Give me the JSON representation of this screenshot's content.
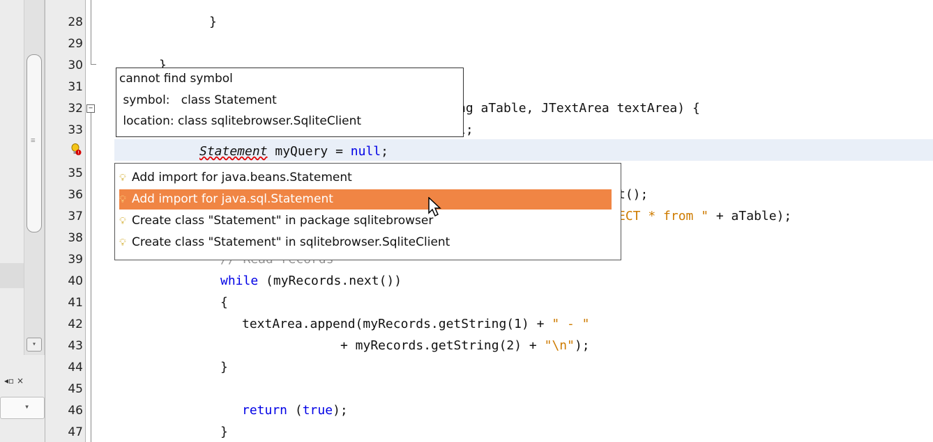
{
  "gutter": {
    "line_numbers": [
      "28",
      "29",
      "30",
      "31",
      "32",
      "33",
      "",
      "35",
      "36",
      "37",
      "38",
      "39",
      "40",
      "41",
      "42",
      "43",
      "44",
      "45",
      "46",
      "47"
    ]
  },
  "side_panel": {
    "tab_close_label": "◂▫ ×"
  },
  "code": {
    "l28": "}",
    "l30": "}",
    "l32_tail": "ng aTable, JTextArea textArea) {",
    "l33_tail": "l;",
    "l34_type": "Statement",
    "l34_rest": " myQuery = ",
    "l34_null": "null",
    "l34_end": ";",
    "l36_tail": "t();",
    "l37_str": "ECT * from \"",
    "l37_rest": " + aTable);",
    "l39_comment": "// Read records",
    "l40_kw": "while",
    "l40_rest": " (myRecords.next())",
    "l41": "{",
    "l42_a": "textArea.append(myRecords.getString(1) + ",
    "l42_str": "\" - \"",
    "l43_a": "+ myRecords.getString(2) + ",
    "l43_str": "\"\\n\"",
    "l43_end": ");",
    "l44": "}",
    "l46_kw": "return",
    "l46_rest": " (",
    "l46_true": "true",
    "l46_end": ");",
    "l47": "}"
  },
  "tooltip": {
    "title": "cannot find symbol",
    "symbol": " symbol:   class Statement",
    "location": " location: class sqlitebrowser.SqliteClient"
  },
  "suggestions": {
    "items": [
      {
        "label": "Add import for java.beans.Statement",
        "selected": false
      },
      {
        "label": "Add import for java.sql.Statement",
        "selected": true
      },
      {
        "label": "Create class \"Statement\" in package sqlitebrowser",
        "selected": false
      },
      {
        "label": "Create class \"Statement\" in sqlitebrowser.SqliteClient",
        "selected": false
      }
    ]
  },
  "colors": {
    "selection": "#f08544",
    "keyword": "#0000e6",
    "string": "#ce7b00",
    "error_underline": "#e00000",
    "current_line": "#e9eff8"
  },
  "icons": [
    "lightbulb-icon",
    "error-hint-icon",
    "fold-minus-icon",
    "mouse-pointer-icon"
  ]
}
